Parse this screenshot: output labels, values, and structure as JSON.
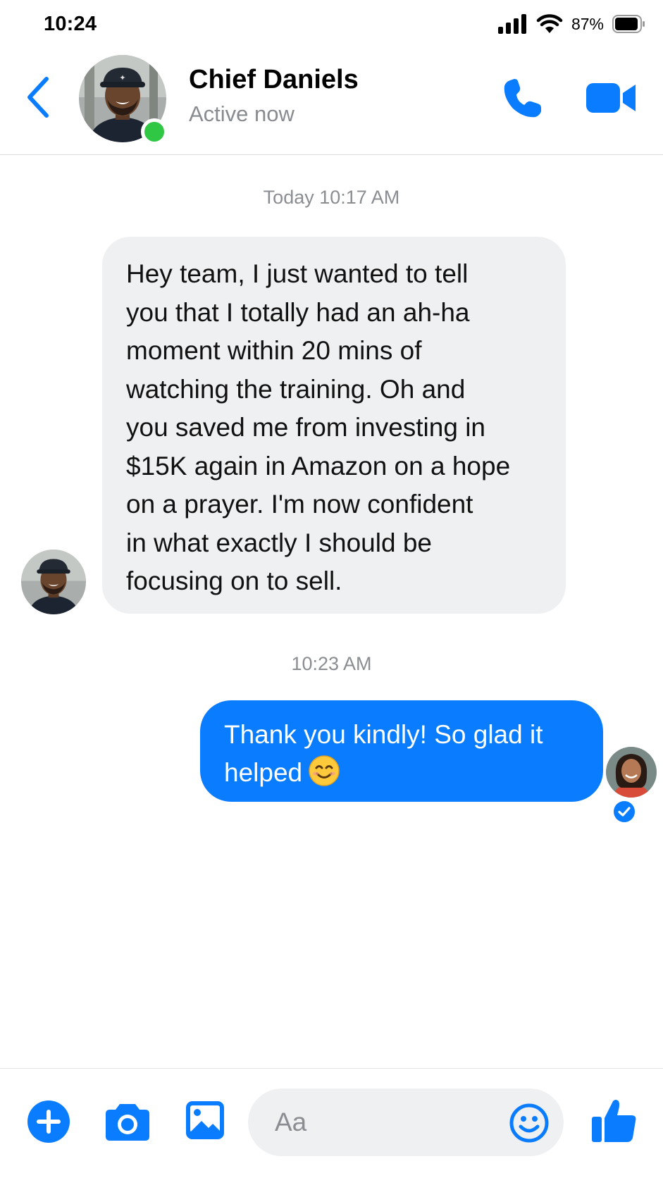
{
  "status_bar": {
    "time": "10:24",
    "battery": "87%"
  },
  "header": {
    "contact_name": "Chief Daniels",
    "contact_status": "Active now"
  },
  "conversation": {
    "timestamp_1": "Today 10:17 AM",
    "incoming_message": "Hey team, I just wanted to tell you that I totally had an ah-ha moment within 20 mins of watching the training. Oh and you saved me from investing in $15K again in Amazon on a hope on a prayer.  I'm now confident in what exactly I should be focusing on to sell.",
    "incoming_lines": [
      "Hey team, I just wanted to tell",
      "you that I totally had an ah-ha",
      "moment within 20 mins of",
      "watching the training. Oh and",
      "you saved me from investing in",
      "$15K again in Amazon on a hope",
      "on a prayer.  I'm now confident",
      "in what exactly I should be",
      "focusing on to sell."
    ],
    "timestamp_2": "10:23 AM",
    "outgoing_line_1": "Thank you kindly! So glad it",
    "outgoing_line_2": "helped"
  },
  "composer": {
    "placeholder": "Aa"
  },
  "icons": {
    "back": "chevron-left-icon",
    "call": "phone-icon",
    "video": "video-camera-icon",
    "plus": "plus-icon",
    "camera": "camera-icon",
    "gallery": "image-icon",
    "emoji": "smiley-icon",
    "like": "thumbs-up-icon",
    "seen": "check-circle-icon"
  },
  "colors": {
    "accent": "#0a7cff",
    "online": "#30c745",
    "incoming_bubble": "#eff0f2"
  }
}
